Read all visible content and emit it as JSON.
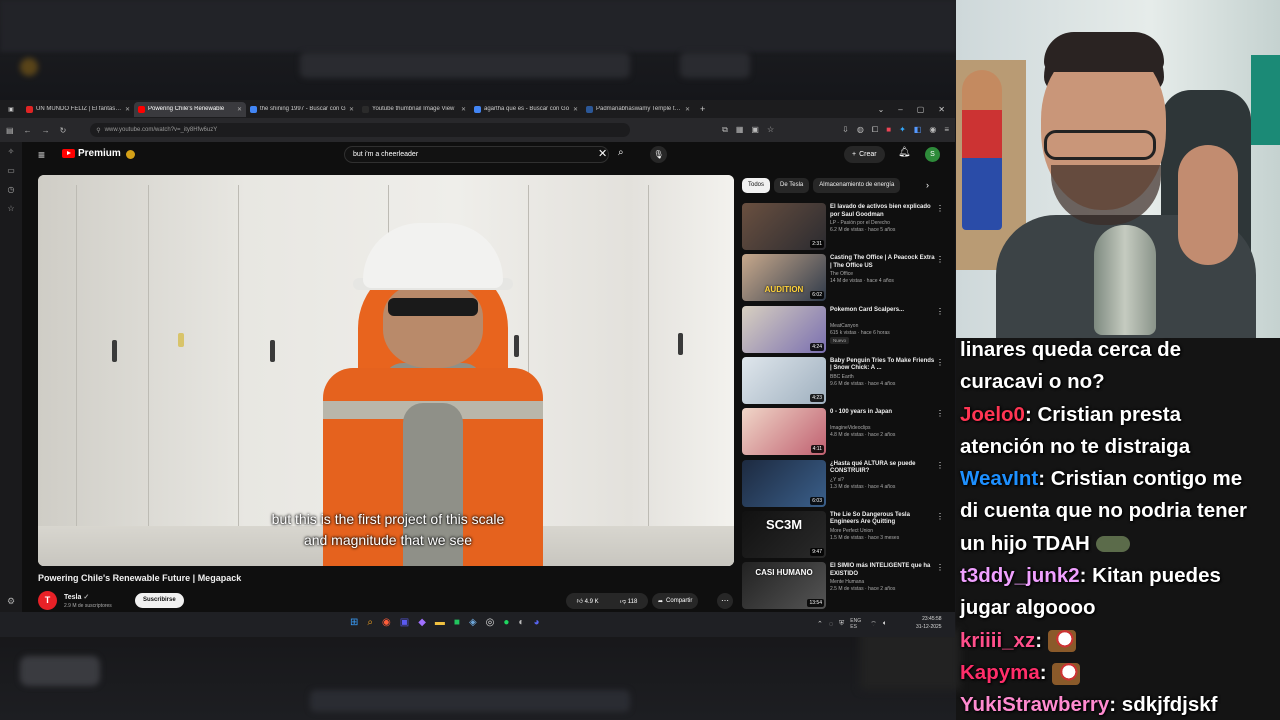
{
  "browser": {
    "tabs": [
      {
        "label": "UN MUNDO FELIZ | El fantasma",
        "fav": "#e02424",
        "active": false
      },
      {
        "label": "Powering Chile's Renewable",
        "fav": "#ff0000",
        "active": true
      },
      {
        "label": "the shining 1997 - Buscar con G",
        "fav": "#4285f4",
        "active": false
      },
      {
        "label": "Youtube thumbnail Image View",
        "fav": "#2b2b2b",
        "active": false
      },
      {
        "label": "agartha que es - Buscar con Go",
        "fav": "#4285f4",
        "active": false
      },
      {
        "label": "Padmanabhaswamy Temple trea",
        "fav": "#2b5797",
        "active": false
      }
    ],
    "url": "www.youtube.com/watch?v=_ity8Hfw6uzY"
  },
  "youtube": {
    "logo_text": "Premium",
    "search_value": "but i'm a cheerleader",
    "create_label": "Crear",
    "avatar_letter": "S",
    "video": {
      "subtitle_line1": "but this is the first project of this scale",
      "subtitle_line2": "and magnitude that we see",
      "title": "Powering Chile's Renewable Future | Megapack",
      "channel": "Tesla",
      "channel_letter": "T",
      "subscribers": "2.9 M de suscriptores",
      "subscribe_label": "Suscribirse",
      "likes": "4.9 K",
      "dislikes": "118",
      "share_label": "Compartir"
    },
    "chips": [
      "Todos",
      "De Tesla",
      "Almacenamiento de energía"
    ],
    "recommendations": [
      {
        "title": "El lavado de activos bien explicado por Saul Goodman",
        "channel": "LP - Pasión por el Derecho",
        "meta": "6.2 M de vistas · hace 5 años",
        "duration": "2:31",
        "thumb": [
          "#6a5040",
          "#2b2b30"
        ],
        "badge": ""
      },
      {
        "title": "Casting The Office | A Peacock Extra | The Office US",
        "channel": "The Office",
        "meta": "14 M de vistas · hace 4 años",
        "duration": "6:02",
        "thumb": [
          "#c8a98c",
          "#2f3a4a"
        ],
        "badge": "",
        "overlay": "AUDITION"
      },
      {
        "title": "Pokemon Card Scalpers...",
        "channel": "MeatCanyon",
        "meta": "615 k vistas · hace 6 horas",
        "duration": "4:24",
        "thumb": [
          "#d8d0c0",
          "#7a6fb0"
        ],
        "badge": "Nuevo"
      },
      {
        "title": "Baby Penguin Tries To Make Friends | Snow Chick: A ...",
        "channel": "BBC Earth",
        "meta": "9.6 M de vistas · hace 4 años",
        "duration": "4:23",
        "thumb": [
          "#dfe6ec",
          "#9fb0bf"
        ],
        "badge": ""
      },
      {
        "title": "0 - 100 years in Japan",
        "channel": "ImagineVideoclips",
        "meta": "4.8 M de vistas · hace 2 años",
        "duration": "4:11",
        "thumb": [
          "#f0d6c8",
          "#c06070"
        ],
        "badge": ""
      },
      {
        "title": "¿Hasta qué ALTURA se puede CONSTRUIR?",
        "channel": "¿Y si?",
        "meta": "1.3 M de vistas · hace 4 años",
        "duration": "6:03",
        "thumb": [
          "#1d2a40",
          "#3a5f8a"
        ],
        "badge": ""
      },
      {
        "title": "The Lie So Dangerous Tesla Engineers Are Quitting",
        "channel": "More Perfect Union",
        "meta": "1.5 M de vistas · hace 3 meses",
        "duration": "9:47",
        "thumb": [
          "#111111",
          "#2a2a2a"
        ],
        "badge": "",
        "overlay": "SC3M"
      },
      {
        "title": "El SIMIO más INTELIGENTE que ha EXISTIDO",
        "channel": "Mente Humana",
        "meta": "2.5 M de vistas · hace 2 años",
        "duration": "13:54",
        "thumb": [
          "#222222",
          "#555555"
        ],
        "badge": "",
        "overlay": "CASI HUMANO"
      }
    ]
  },
  "taskbar": {
    "tray_lang": "ENG ES",
    "time": "23:45:58",
    "date": "31-12-2025"
  },
  "chat": [
    {
      "user": "",
      "color": "#ffffff",
      "text": "linares queda cerca de"
    },
    {
      "user": "",
      "color": "#ffffff",
      "text": "curacavi o no?"
    },
    {
      "user": "Joelo0",
      "color": "#ff3553",
      "text": "Cristian presta"
    },
    {
      "user": "",
      "color": "#ffffff",
      "text": "atención no te distraiga"
    },
    {
      "user": "WeavInt",
      "color": "#1e90ff",
      "text": "Cristian contigo me"
    },
    {
      "user": "",
      "color": "#ffffff",
      "text": "di cuenta que no podria tener"
    },
    {
      "user": "",
      "color": "#ffffff",
      "text": "un hijo TDAH",
      "emote": "frog"
    },
    {
      "user": "t3ddy_junk2",
      "color": "#f0a0ff",
      "text": "Kitan puedes"
    },
    {
      "user": "",
      "color": "#ffffff",
      "text": "jugar algoooo"
    },
    {
      "user": "kriiii_xz",
      "color": "#ff4f8b",
      "text": "",
      "emote": "rooster"
    },
    {
      "user": "Kapyma",
      "color": "#ff2e6a",
      "text": "",
      "emote": "rooster"
    },
    {
      "user": "YukiStrawberry",
      "color": "#ff8bd0",
      "text": "sdkjfdjskf"
    }
  ]
}
